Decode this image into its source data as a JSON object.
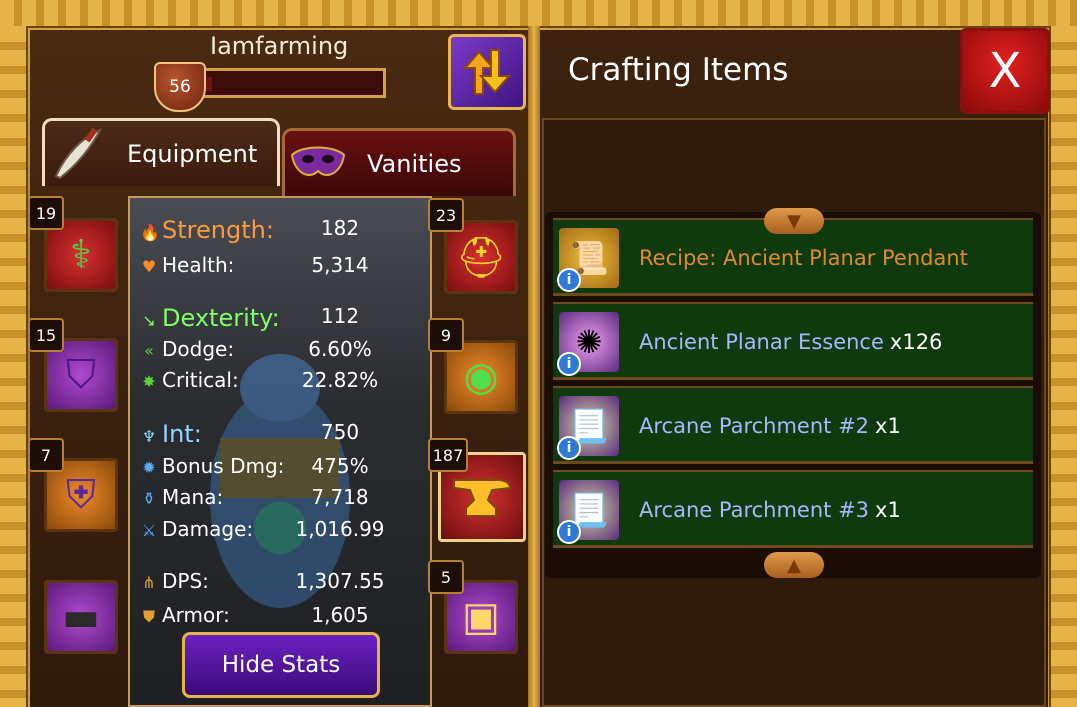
{
  "player": {
    "name": "Iamfarming",
    "level": "56",
    "xp_fraction": 0.04
  },
  "tabs": {
    "equipment": "Equipment",
    "vanities": "Vanities"
  },
  "stats": {
    "strength": {
      "label": "Strength:",
      "value": "182"
    },
    "health": {
      "label": "Health:",
      "value": "5,314"
    },
    "dexterity": {
      "label": "Dexterity:",
      "value": "112"
    },
    "dodge": {
      "label": "Dodge:",
      "value": "6.60%"
    },
    "critical": {
      "label": "Critical:",
      "value": "22.82%"
    },
    "int": {
      "label": "Int:",
      "value": "750"
    },
    "bonus_dmg": {
      "label": "Bonus Dmg:",
      "value": "475%"
    },
    "mana": {
      "label": "Mana:",
      "value": "7,718"
    },
    "damage": {
      "label": "Damage:",
      "value": "1,016.99"
    },
    "dps": {
      "label": "DPS:",
      "value": "1,307.55"
    },
    "armor": {
      "label": "Armor:",
      "value": "1,605"
    }
  },
  "hide_stats_label": "Hide Stats",
  "slots_left": [
    {
      "badge": "19",
      "icon": "dragon-staff-icon"
    },
    {
      "badge": "15",
      "icon": "hood-icon"
    },
    {
      "badge": "7",
      "icon": "armor-vest-icon"
    },
    {
      "badge": "",
      "icon": "belt-icon"
    }
  ],
  "slots_right": [
    {
      "badge": "23",
      "icon": "gold-pauldron-icon"
    },
    {
      "badge": "9",
      "icon": "amulet-icon"
    },
    {
      "badge": "187",
      "icon": "anvil-icon"
    },
    {
      "badge": "5",
      "icon": "treasure-chest-icon"
    }
  ],
  "crafting": {
    "title": "Crafting Items",
    "close_label": "X",
    "items": [
      {
        "name": "Recipe: Ancient Planar Pendant",
        "qty": "",
        "color": "#e0892c",
        "icon": "recipe-scroll-icon"
      },
      {
        "name": "Ancient Planar Essence",
        "qty": "x126",
        "color": "#a9b7ff",
        "icon": "essence-orb-icon"
      },
      {
        "name": "Arcane Parchment #2",
        "qty": "x1",
        "color": "#a9b7ff",
        "icon": "parchment-icon"
      },
      {
        "name": "Arcane Parchment #3",
        "qty": "x1",
        "color": "#a9b7ff",
        "icon": "parchment-icon"
      }
    ]
  },
  "colors": {
    "strength": "#ff9a3c",
    "dexterity": "#7fff66",
    "int": "#8fd8ff"
  }
}
